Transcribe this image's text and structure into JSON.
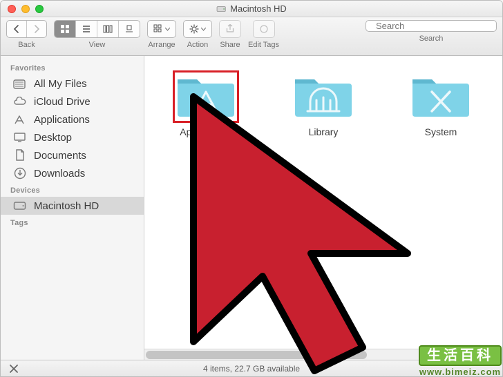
{
  "window": {
    "title": "Macintosh HD"
  },
  "toolbar": {
    "back_label": "Back",
    "view_label": "View",
    "arrange_label": "Arrange",
    "action_label": "Action",
    "share_label": "Share",
    "edit_tags_label": "Edit Tags",
    "search_label": "Search",
    "search_placeholder": "Search"
  },
  "sidebar": {
    "sections": [
      {
        "header": "Favorites",
        "items": [
          {
            "label": "All My Files",
            "icon": "all-my-files"
          },
          {
            "label": "iCloud Drive",
            "icon": "icloud"
          },
          {
            "label": "Applications",
            "icon": "applications"
          },
          {
            "label": "Desktop",
            "icon": "desktop"
          },
          {
            "label": "Documents",
            "icon": "documents"
          },
          {
            "label": "Downloads",
            "icon": "downloads"
          }
        ]
      },
      {
        "header": "Devices",
        "items": [
          {
            "label": "Macintosh HD",
            "icon": "hd",
            "selected": true
          }
        ]
      },
      {
        "header": "Tags",
        "items": []
      }
    ]
  },
  "content": {
    "folders": [
      {
        "name": "Applications",
        "glyph": "A",
        "highlighted": true
      },
      {
        "name": "Library",
        "glyph": "library"
      },
      {
        "name": "System",
        "glyph": "X"
      }
    ]
  },
  "status": {
    "text": "4 items, 22.7 GB available"
  },
  "watermark": {
    "cn": "生活百科",
    "url": "www.bimeiz.com"
  },
  "colors": {
    "folder": "#7fd3e8",
    "folder_shadow": "#5fb8d0",
    "cursor_fill": "#c8202f",
    "cursor_stroke": "#000000"
  }
}
